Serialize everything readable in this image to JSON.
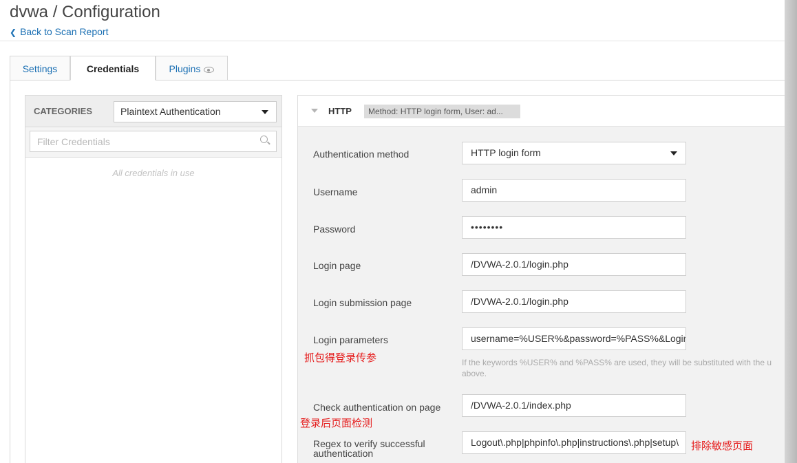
{
  "header": {
    "title": "dvwa / Configuration",
    "back_link": "Back to Scan Report"
  },
  "tabs": [
    {
      "label": "Settings"
    },
    {
      "label": "Credentials"
    },
    {
      "label": "Plugins"
    }
  ],
  "categories": {
    "label": "CATEGORIES",
    "selected": "Plaintext Authentication",
    "filter_placeholder": "Filter Credentials",
    "empty_text": "All credentials in use"
  },
  "http": {
    "title": "HTTP",
    "badge": "Method: HTTP login form, User: ad...",
    "fields": {
      "auth_method": {
        "label": "Authentication method",
        "value": "HTTP login form"
      },
      "username": {
        "label": "Username",
        "value": "admin"
      },
      "password": {
        "label": "Password",
        "value": "••••••••"
      },
      "login_page": {
        "label": "Login page",
        "value": "/DVWA-2.0.1/login.php"
      },
      "submission_page": {
        "label": "Login submission page",
        "value": "/DVWA-2.0.1/login.php"
      },
      "login_params": {
        "label": "Login parameters",
        "value": "username=%USER%&password=%PASS%&Login="
      },
      "check_page": {
        "label": "Check authentication on page",
        "value": "/DVWA-2.0.1/index.php"
      },
      "regex": {
        "label_line1": "Regex to verify successful",
        "label_line2": "authentication",
        "value": "Logout\\.php|phpinfo\\.php|instructions\\.php|setup\\"
      }
    },
    "help_text": "If the keywords %USER% and %PASS% are used, they will be substituted with the u above."
  },
  "annotations": {
    "capture_params": "抓包得登录传参",
    "post_login_check": "登录后页面检测",
    "exclude_sensitive": "排除敏感页面"
  },
  "colors": {
    "link": "#1a6fb3",
    "annotation": "#e51a1a"
  }
}
